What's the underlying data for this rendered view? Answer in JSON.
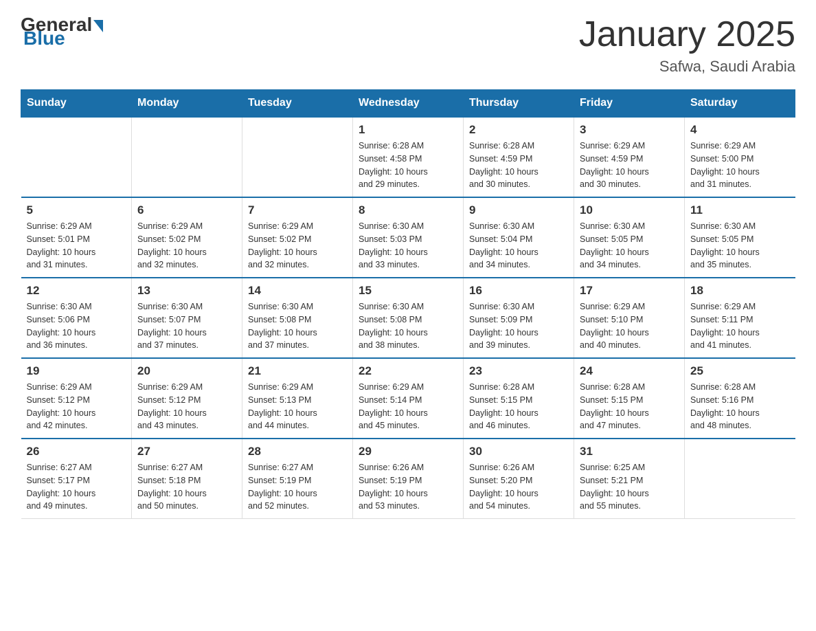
{
  "logo": {
    "general": "General",
    "blue": "Blue"
  },
  "title": "January 2025",
  "subtitle": "Safwa, Saudi Arabia",
  "days": [
    "Sunday",
    "Monday",
    "Tuesday",
    "Wednesday",
    "Thursday",
    "Friday",
    "Saturday"
  ],
  "weeks": [
    [
      {
        "day": "",
        "info": ""
      },
      {
        "day": "",
        "info": ""
      },
      {
        "day": "",
        "info": ""
      },
      {
        "day": "1",
        "info": "Sunrise: 6:28 AM\nSunset: 4:58 PM\nDaylight: 10 hours\nand 29 minutes."
      },
      {
        "day": "2",
        "info": "Sunrise: 6:28 AM\nSunset: 4:59 PM\nDaylight: 10 hours\nand 30 minutes."
      },
      {
        "day": "3",
        "info": "Sunrise: 6:29 AM\nSunset: 4:59 PM\nDaylight: 10 hours\nand 30 minutes."
      },
      {
        "day": "4",
        "info": "Sunrise: 6:29 AM\nSunset: 5:00 PM\nDaylight: 10 hours\nand 31 minutes."
      }
    ],
    [
      {
        "day": "5",
        "info": "Sunrise: 6:29 AM\nSunset: 5:01 PM\nDaylight: 10 hours\nand 31 minutes."
      },
      {
        "day": "6",
        "info": "Sunrise: 6:29 AM\nSunset: 5:02 PM\nDaylight: 10 hours\nand 32 minutes."
      },
      {
        "day": "7",
        "info": "Sunrise: 6:29 AM\nSunset: 5:02 PM\nDaylight: 10 hours\nand 32 minutes."
      },
      {
        "day": "8",
        "info": "Sunrise: 6:30 AM\nSunset: 5:03 PM\nDaylight: 10 hours\nand 33 minutes."
      },
      {
        "day": "9",
        "info": "Sunrise: 6:30 AM\nSunset: 5:04 PM\nDaylight: 10 hours\nand 34 minutes."
      },
      {
        "day": "10",
        "info": "Sunrise: 6:30 AM\nSunset: 5:05 PM\nDaylight: 10 hours\nand 34 minutes."
      },
      {
        "day": "11",
        "info": "Sunrise: 6:30 AM\nSunset: 5:05 PM\nDaylight: 10 hours\nand 35 minutes."
      }
    ],
    [
      {
        "day": "12",
        "info": "Sunrise: 6:30 AM\nSunset: 5:06 PM\nDaylight: 10 hours\nand 36 minutes."
      },
      {
        "day": "13",
        "info": "Sunrise: 6:30 AM\nSunset: 5:07 PM\nDaylight: 10 hours\nand 37 minutes."
      },
      {
        "day": "14",
        "info": "Sunrise: 6:30 AM\nSunset: 5:08 PM\nDaylight: 10 hours\nand 37 minutes."
      },
      {
        "day": "15",
        "info": "Sunrise: 6:30 AM\nSunset: 5:08 PM\nDaylight: 10 hours\nand 38 minutes."
      },
      {
        "day": "16",
        "info": "Sunrise: 6:30 AM\nSunset: 5:09 PM\nDaylight: 10 hours\nand 39 minutes."
      },
      {
        "day": "17",
        "info": "Sunrise: 6:29 AM\nSunset: 5:10 PM\nDaylight: 10 hours\nand 40 minutes."
      },
      {
        "day": "18",
        "info": "Sunrise: 6:29 AM\nSunset: 5:11 PM\nDaylight: 10 hours\nand 41 minutes."
      }
    ],
    [
      {
        "day": "19",
        "info": "Sunrise: 6:29 AM\nSunset: 5:12 PM\nDaylight: 10 hours\nand 42 minutes."
      },
      {
        "day": "20",
        "info": "Sunrise: 6:29 AM\nSunset: 5:12 PM\nDaylight: 10 hours\nand 43 minutes."
      },
      {
        "day": "21",
        "info": "Sunrise: 6:29 AM\nSunset: 5:13 PM\nDaylight: 10 hours\nand 44 minutes."
      },
      {
        "day": "22",
        "info": "Sunrise: 6:29 AM\nSunset: 5:14 PM\nDaylight: 10 hours\nand 45 minutes."
      },
      {
        "day": "23",
        "info": "Sunrise: 6:28 AM\nSunset: 5:15 PM\nDaylight: 10 hours\nand 46 minutes."
      },
      {
        "day": "24",
        "info": "Sunrise: 6:28 AM\nSunset: 5:15 PM\nDaylight: 10 hours\nand 47 minutes."
      },
      {
        "day": "25",
        "info": "Sunrise: 6:28 AM\nSunset: 5:16 PM\nDaylight: 10 hours\nand 48 minutes."
      }
    ],
    [
      {
        "day": "26",
        "info": "Sunrise: 6:27 AM\nSunset: 5:17 PM\nDaylight: 10 hours\nand 49 minutes."
      },
      {
        "day": "27",
        "info": "Sunrise: 6:27 AM\nSunset: 5:18 PM\nDaylight: 10 hours\nand 50 minutes."
      },
      {
        "day": "28",
        "info": "Sunrise: 6:27 AM\nSunset: 5:19 PM\nDaylight: 10 hours\nand 52 minutes."
      },
      {
        "day": "29",
        "info": "Sunrise: 6:26 AM\nSunset: 5:19 PM\nDaylight: 10 hours\nand 53 minutes."
      },
      {
        "day": "30",
        "info": "Sunrise: 6:26 AM\nSunset: 5:20 PM\nDaylight: 10 hours\nand 54 minutes."
      },
      {
        "day": "31",
        "info": "Sunrise: 6:25 AM\nSunset: 5:21 PM\nDaylight: 10 hours\nand 55 minutes."
      },
      {
        "day": "",
        "info": ""
      }
    ]
  ]
}
